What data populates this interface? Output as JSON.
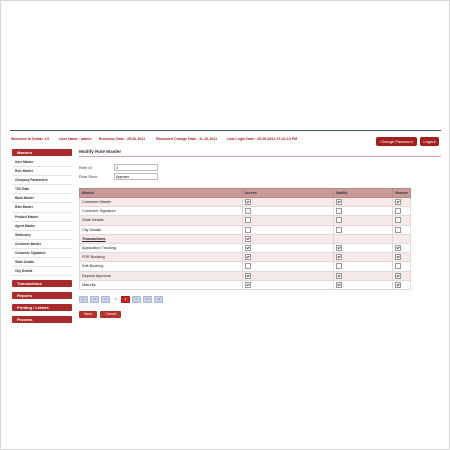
{
  "header": {
    "welcome": "Welcome to Detrac 1.0",
    "user": "User Name : admin",
    "business_date": "Business Date : 25-06-2011",
    "password_change": "Password Change Date : 11-10-2011",
    "last_login": "Last Login Date : 25-06-2011 07:24:19 PM",
    "change_password_label": "Change Password",
    "logout_label": "Logout"
  },
  "sidebar": {
    "masters_label": "Masters",
    "items": [
      "User Master",
      "Role Master",
      "Company Parameters",
      "TDS Rate",
      "Bank Master",
      "Rate Master",
      "Product Master",
      "Agent Master",
      "Stationary",
      "Customer Master",
      "Customer Signature",
      "State Details",
      "City Details"
    ],
    "sections": [
      "Transactions",
      "Reports",
      "Printing / Letters",
      "Process"
    ]
  },
  "page": {
    "title": "Modify Role Master",
    "role_id_label": "Role Id",
    "role_id_value": "3",
    "role_desc_label": "Role Desc",
    "role_desc_value": "Approver"
  },
  "table": {
    "headers": [
      "Module",
      "Access",
      "Modify",
      "Browse"
    ],
    "rows": [
      {
        "module": "Customer Master",
        "access": true,
        "modify": true,
        "browse": true
      },
      {
        "module": "Customer Signature",
        "access": false,
        "modify": false,
        "browse": false
      },
      {
        "module": "State Details",
        "access": false,
        "modify": false,
        "browse": false
      },
      {
        "module": "City Details",
        "access": false,
        "modify": false,
        "browse": false
      },
      {
        "module": "Transactions",
        "section": true,
        "access": true
      },
      {
        "module": "Application Tracking",
        "access": true,
        "modify": true,
        "browse": true
      },
      {
        "module": "FDR Booking",
        "access": true,
        "modify": true,
        "browse": true
      },
      {
        "module": "Edit Booking",
        "access": false,
        "modify": false,
        "browse": false
      },
      {
        "module": "Deposit Approval",
        "access": true,
        "modify": true,
        "browse": true
      },
      {
        "module": "Maturity",
        "access": true,
        "modify": true,
        "browse": true
      }
    ]
  },
  "pagination": {
    "first": "|<",
    "prev_group": "<<",
    "prev": "<",
    "pages": [
      "1",
      "2"
    ],
    "current": "2",
    "next": ">",
    "next_group": ">>",
    "last": ">|"
  },
  "actions": {
    "save_label": "Save",
    "cancel_label": "Cancel"
  }
}
